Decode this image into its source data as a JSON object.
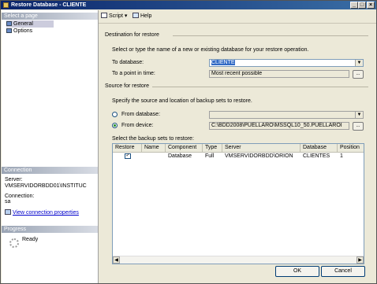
{
  "window": {
    "title": "Restore Database - CLIENTE"
  },
  "sidebar": {
    "select_page_header": "Select a page",
    "pages": [
      {
        "label": "General",
        "selected": true
      },
      {
        "label": "Options",
        "selected": false
      }
    ],
    "connection_header": "Connection",
    "server_label": "Server:",
    "server_value": "VMSERVIDORBDD01\\INSTITUC",
    "connection_label": "Connection:",
    "connection_value": "sa",
    "view_connection_properties": "View connection properties",
    "progress_header": "Progress",
    "progress_status": "Ready"
  },
  "toolbar": {
    "script_label": "Script",
    "help_label": "Help"
  },
  "destination": {
    "section_title": "Destination for restore",
    "description": "Select or type the name of a new or existing database for your restore operation.",
    "to_database_label": "To database:",
    "to_database_value": "CLIENTE",
    "point_in_time_label": "To a point in time:",
    "point_in_time_value": "Most recent possible",
    "browse_label": "..."
  },
  "source": {
    "section_title": "Source for restore",
    "description": "Specify the source and location of backup sets to restore.",
    "from_database_label": "From database:",
    "from_device_label": "From device:",
    "from_device_value": "C:\\BDD2008\\PUELLARO\\MSSQL10_50.PUELLAROI",
    "browse_label": "...",
    "selected_option": "device"
  },
  "backup_sets": {
    "label": "Select the backup sets to restore:",
    "columns": [
      "Restore",
      "Name",
      "Component",
      "Type",
      "Server",
      "Database",
      "Position"
    ],
    "rows": [
      {
        "restore": true,
        "name": "",
        "component": "Database",
        "type": "Full",
        "server": "VMSERVIDORBDD\\ORION",
        "database": "CLIENTES",
        "position": "1"
      }
    ]
  },
  "buttons": {
    "ok": "OK",
    "cancel": "Cancel"
  }
}
